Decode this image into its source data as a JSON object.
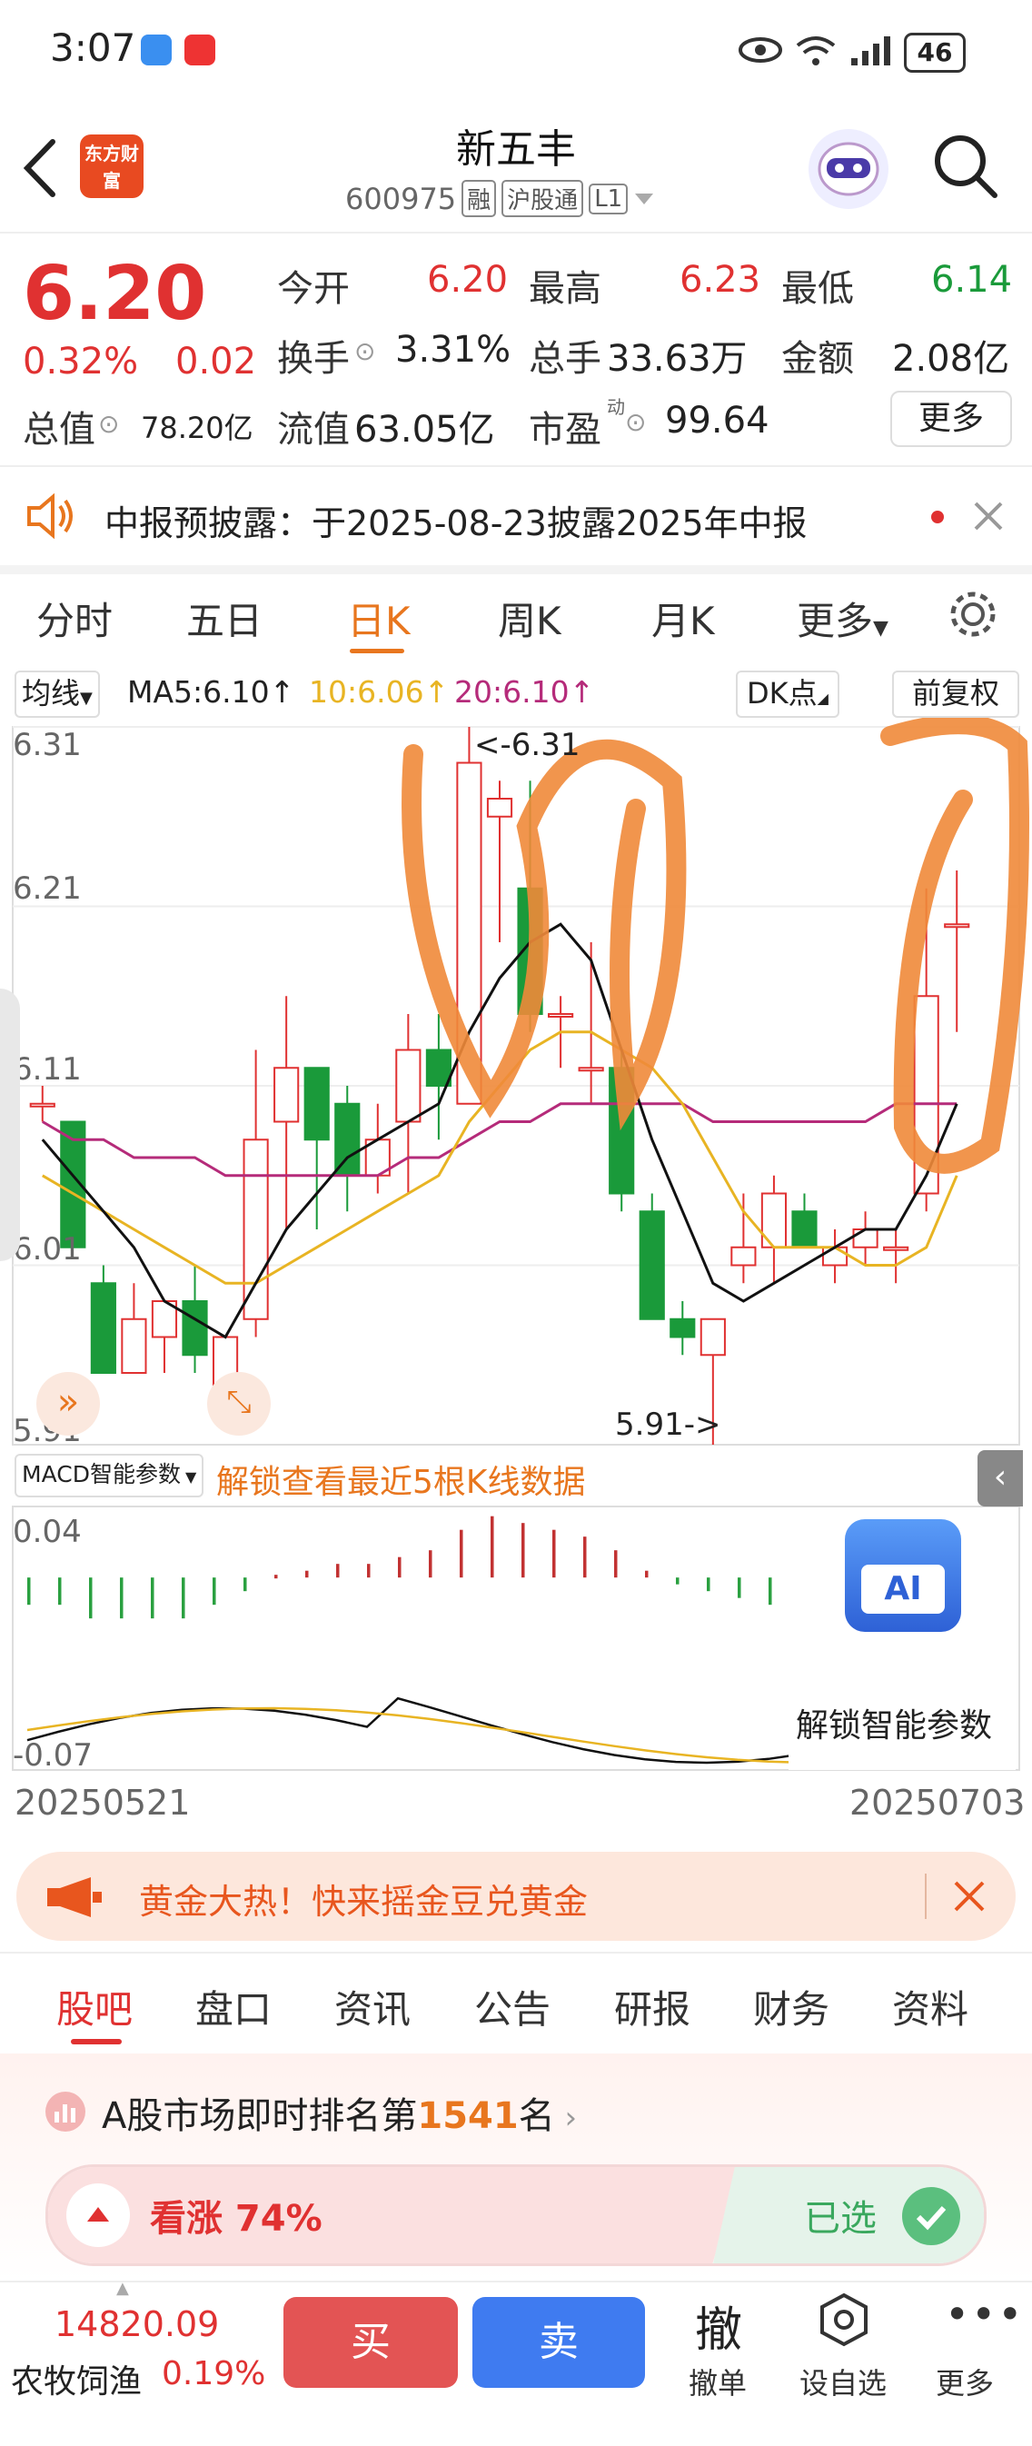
{
  "status_bar": {
    "time": "3:07",
    "battery": "46"
  },
  "header": {
    "logo_text": "东方财富",
    "stock_name": "新五丰",
    "stock_code": "600975",
    "tags": [
      "融",
      "沪股通",
      "L1"
    ]
  },
  "quote": {
    "price": "6.20",
    "change_pct": "0.32%",
    "change_amt": "0.02",
    "total_value_label": "总值",
    "total_value": "78.20亿",
    "open_label": "今开",
    "open": "6.20",
    "high_label": "最高",
    "high": "6.23",
    "low_label": "最低",
    "low": "6.14",
    "turnover_label": "换手",
    "turnover": "3.31%",
    "volume_label": "总手",
    "volume": "33.63万",
    "amount_label": "金额",
    "amount": "2.08亿",
    "float_label": "流值",
    "float_value": "63.05亿",
    "pe_label": "市盈",
    "pe_sup": "动",
    "pe": "99.64",
    "more_label": "更多"
  },
  "notice": {
    "text": "中报预披露：于2025-08-23披露2025年中报"
  },
  "chart_tabs": {
    "tabs": [
      "分时",
      "五日",
      "日K",
      "周K",
      "月K"
    ],
    "more": "更多",
    "active": "日K"
  },
  "chart_header": {
    "ma_select": "均线",
    "ma5": "MA5:6.10↑",
    "ma10": "10:6.06↑",
    "ma20": "20:6.10↑",
    "dk": "DK点",
    "adjust": "前复权"
  },
  "chart_data": {
    "type": "candlestick",
    "y_ticks": [
      "6.31",
      "6.21",
      "6.11",
      "6.01",
      "5.91"
    ],
    "ylim": [
      5.91,
      6.31
    ],
    "high_marker": "<-6.31",
    "low_marker": "5.91->",
    "candles": [
      {
        "o": 6.1,
        "c": 6.1,
        "h": 6.11,
        "l": 6.09
      },
      {
        "o": 6.09,
        "c": 6.02,
        "h": 6.09,
        "l": 6.02
      },
      {
        "o": 6.0,
        "c": 5.95,
        "h": 6.01,
        "l": 5.95
      },
      {
        "o": 5.95,
        "c": 5.98,
        "h": 6.0,
        "l": 5.95
      },
      {
        "o": 5.97,
        "c": 5.99,
        "h": 5.99,
        "l": 5.95
      },
      {
        "o": 5.99,
        "c": 5.96,
        "h": 6.01,
        "l": 5.95
      },
      {
        "o": 5.94,
        "c": 5.97,
        "h": 5.97,
        "l": 5.94
      },
      {
        "o": 5.98,
        "c": 6.08,
        "h": 6.13,
        "l": 5.97
      },
      {
        "o": 6.09,
        "c": 6.12,
        "h": 6.16,
        "l": 6.03
      },
      {
        "o": 6.12,
        "c": 6.08,
        "h": 6.12,
        "l": 6.03
      },
      {
        "o": 6.1,
        "c": 6.06,
        "h": 6.11,
        "l": 6.04
      },
      {
        "o": 6.06,
        "c": 6.08,
        "h": 6.1,
        "l": 6.05
      },
      {
        "o": 6.09,
        "c": 6.13,
        "h": 6.15,
        "l": 6.05
      },
      {
        "o": 6.13,
        "c": 6.11,
        "h": 6.15,
        "l": 6.08
      },
      {
        "o": 6.1,
        "c": 6.29,
        "h": 6.31,
        "l": 6.1
      },
      {
        "o": 6.26,
        "c": 6.27,
        "h": 6.28,
        "l": 6.19
      },
      {
        "o": 6.22,
        "c": 6.15,
        "h": 6.28,
        "l": 6.14
      },
      {
        "o": 6.15,
        "c": 6.15,
        "h": 6.16,
        "l": 6.12
      },
      {
        "o": 6.12,
        "c": 6.12,
        "h": 6.19,
        "l": 6.1
      },
      {
        "o": 6.12,
        "c": 6.05,
        "h": 6.13,
        "l": 6.04
      },
      {
        "o": 6.04,
        "c": 5.98,
        "h": 6.05,
        "l": 5.98
      },
      {
        "o": 5.98,
        "c": 5.97,
        "h": 5.99,
        "l": 5.96
      },
      {
        "o": 5.96,
        "c": 5.98,
        "h": 5.98,
        "l": 5.91
      },
      {
        "o": 6.01,
        "c": 6.02,
        "h": 6.05,
        "l": 6.0
      },
      {
        "o": 6.02,
        "c": 6.05,
        "h": 6.06,
        "l": 6.0
      },
      {
        "o": 6.04,
        "c": 6.02,
        "h": 6.05,
        "l": 6.02
      },
      {
        "o": 6.01,
        "c": 6.02,
        "h": 6.03,
        "l": 6.0
      },
      {
        "o": 6.02,
        "c": 6.03,
        "h": 6.04,
        "l": 6.01
      },
      {
        "o": 6.02,
        "c": 6.02,
        "h": 6.03,
        "l": 6.0
      },
      {
        "o": 6.05,
        "c": 6.16,
        "h": 6.22,
        "l": 6.04
      },
      {
        "o": 6.2,
        "c": 6.2,
        "h": 6.23,
        "l": 6.14
      }
    ],
    "ma5": [
      6.08,
      6.06,
      6.04,
      6.02,
      5.99,
      5.98,
      5.97,
      6.0,
      6.03,
      6.05,
      6.07,
      6.08,
      6.09,
      6.1,
      6.14,
      6.17,
      6.19,
      6.2,
      6.18,
      6.13,
      6.08,
      6.04,
      6.0,
      5.99,
      6.0,
      6.01,
      6.02,
      6.03,
      6.03,
      6.06,
      6.1
    ],
    "ma10": [
      6.06,
      6.05,
      6.04,
      6.03,
      6.02,
      6.01,
      6.0,
      6.0,
      6.01,
      6.02,
      6.03,
      6.04,
      6.05,
      6.06,
      6.09,
      6.11,
      6.13,
      6.14,
      6.14,
      6.13,
      6.12,
      6.1,
      6.07,
      6.04,
      6.02,
      6.02,
      6.02,
      6.01,
      6.01,
      6.02,
      6.06
    ],
    "ma20": [
      6.09,
      6.08,
      6.08,
      6.07,
      6.07,
      6.07,
      6.06,
      6.06,
      6.06,
      6.06,
      6.06,
      6.06,
      6.07,
      6.07,
      6.08,
      6.09,
      6.09,
      6.1,
      6.1,
      6.1,
      6.1,
      6.1,
      6.09,
      6.09,
      6.09,
      6.09,
      6.09,
      6.09,
      6.1,
      6.1,
      6.1
    ]
  },
  "macd": {
    "select": "MACD智能参数",
    "unlock_text": "解锁查看最近5根K线数据",
    "y_top": "0.04",
    "y_bottom": "-0.07",
    "unlock_params": "解锁智能参数",
    "ai_label": "AI",
    "histogram": [
      -0.02,
      -0.02,
      -0.03,
      -0.03,
      -0.03,
      -0.03,
      -0.02,
      -0.01,
      0.002,
      0.005,
      0.01,
      0.01,
      0.015,
      0.02,
      0.035,
      0.045,
      0.04,
      0.035,
      0.03,
      0.02,
      0.005,
      -0.005,
      -0.01,
      -0.015,
      -0.02
    ]
  },
  "dates": {
    "start": "20250521",
    "end": "20250703"
  },
  "banner": {
    "text": "黄金大热！快来摇金豆兑黄金"
  },
  "bottom_tabs": {
    "tabs": [
      "股吧",
      "盘口",
      "资讯",
      "公告",
      "研报",
      "财务",
      "资料"
    ],
    "active": "股吧"
  },
  "rank": {
    "prefix": "A股市场即时排名第",
    "number": "1541",
    "suffix": "名"
  },
  "vote": {
    "up_label": "看涨 74%",
    "selected_label": "已选",
    "up_ratio": 0.74
  },
  "bottom_bar": {
    "index_value": "14820.09",
    "index_name": "农牧饲渔",
    "index_change": "0.19%",
    "buy": "买",
    "sell": "卖",
    "cancel_icon": "撤",
    "cancel_label": "撤单",
    "setting_label": "设自选",
    "more_label": "更多"
  }
}
